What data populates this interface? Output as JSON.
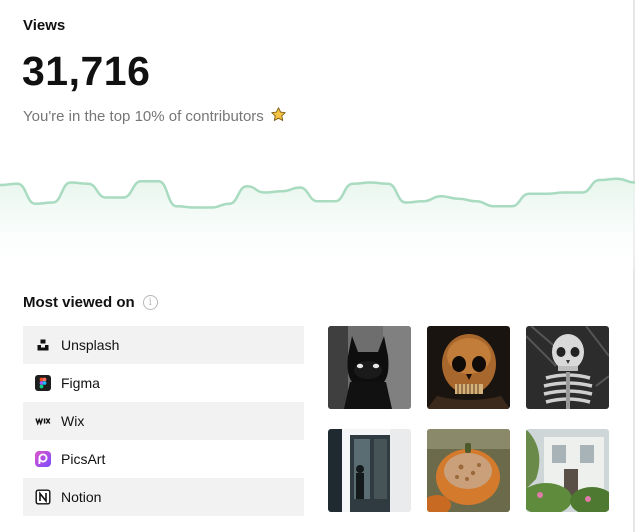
{
  "stats": {
    "label": "Views",
    "value": "31,716",
    "subtitle": "You're in the top 10% of contributors",
    "subtitle_icon": "star-icon"
  },
  "chart_data": {
    "type": "area",
    "title": "",
    "xlabel": "",
    "ylabel": "",
    "grid": false,
    "y": [
      68,
      69,
      53,
      54,
      70,
      69,
      58,
      58,
      71,
      71,
      51,
      50,
      50,
      53,
      67,
      62,
      63,
      66,
      55,
      55,
      69,
      70,
      69,
      54,
      55,
      59,
      57,
      55,
      51,
      51,
      61,
      61,
      62,
      62,
      72,
      73,
      70
    ],
    "ylim": [
      0,
      80
    ],
    "line_color": "#a9dbc0",
    "fill_color": "#eaf7ef"
  },
  "most_viewed": {
    "title": "Most viewed on",
    "info_icon": "info-icon",
    "platforms": [
      {
        "label": "Unsplash",
        "icon": "unsplash-icon"
      },
      {
        "label": "Figma",
        "icon": "figma-icon"
      },
      {
        "label": "Wix",
        "icon": "wix-icon"
      },
      {
        "label": "PicsArt",
        "icon": "picsart-icon"
      },
      {
        "label": "Notion",
        "icon": "notion-icon"
      }
    ],
    "photos": [
      {
        "subject": "batman-figure"
      },
      {
        "subject": "orange-skull"
      },
      {
        "subject": "skeleton"
      },
      {
        "subject": "doorway"
      },
      {
        "subject": "pumpkin"
      },
      {
        "subject": "house-garden"
      }
    ]
  }
}
